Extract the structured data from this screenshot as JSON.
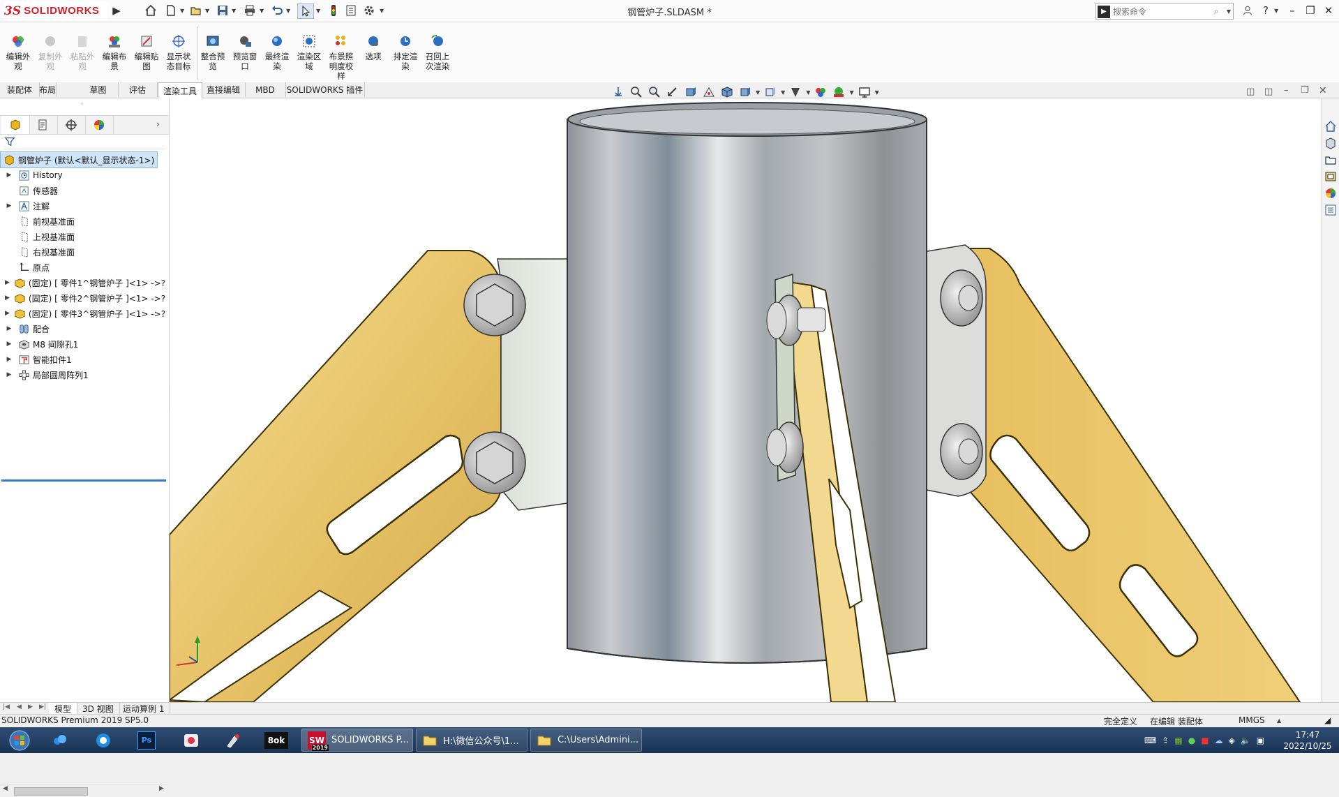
{
  "app": {
    "brand_ds": "3S",
    "brand_name": "SOLIDWORKS",
    "document_title": "钢管炉子.SLDASM *"
  },
  "search": {
    "placeholder": "搜索命令"
  },
  "command_manager": {
    "items": [
      {
        "label": "编辑外观",
        "enabled": true,
        "icon": "edit-appearance-icon"
      },
      {
        "label": "复制外观",
        "enabled": false,
        "icon": "copy-appearance-icon"
      },
      {
        "label": "粘贴外观",
        "enabled": false,
        "icon": "paste-appearance-icon"
      },
      {
        "label": "编辑布景",
        "enabled": true,
        "icon": "edit-scene-icon"
      },
      {
        "label": "编辑贴图",
        "enabled": true,
        "icon": "edit-decal-icon"
      },
      {
        "label": "显示状态目标",
        "enabled": true,
        "icon": "display-state-target-icon"
      },
      {
        "label": "整合预览",
        "enabled": true,
        "icon": "integrated-preview-icon"
      },
      {
        "label": "预览窗口",
        "enabled": true,
        "icon": "preview-window-icon"
      },
      {
        "label": "最终渲染",
        "enabled": true,
        "icon": "final-render-icon"
      },
      {
        "label": "渲染区域",
        "enabled": true,
        "icon": "render-region-icon"
      },
      {
        "label": "布景照明度校样",
        "enabled": true,
        "icon": "scene-illumination-proof-icon"
      },
      {
        "label": "选项",
        "enabled": true,
        "icon": "options-icon"
      },
      {
        "label": "排定渲染",
        "enabled": true,
        "icon": "schedule-render-icon"
      },
      {
        "label": "召回上次渲染",
        "enabled": true,
        "icon": "recall-last-render-icon"
      }
    ]
  },
  "tabs": [
    "装配体",
    "布局",
    "草图",
    "评估",
    "渲染工具",
    "直接编辑",
    "MBD",
    "SOLIDWORKS 插件"
  ],
  "active_tab": "渲染工具",
  "feature_tree": {
    "root": "钢管炉子  (默认<默认_显示状态-1>)",
    "items": [
      {
        "label": "History",
        "icon": "history-icon",
        "expandable": true
      },
      {
        "label": "传感器",
        "icon": "sensor-icon",
        "expandable": false
      },
      {
        "label": "注解",
        "icon": "annotation-icon",
        "expandable": true
      },
      {
        "label": "前视基准面",
        "icon": "plane-icon",
        "expandable": false
      },
      {
        "label": "上视基准面",
        "icon": "plane-icon",
        "expandable": false
      },
      {
        "label": "右视基准面",
        "icon": "plane-icon",
        "expandable": false
      },
      {
        "label": "原点",
        "icon": "origin-icon",
        "expandable": false
      },
      {
        "label": "(固定) [ 零件1^钢管炉子 ]<1> ->?",
        "icon": "part-icon",
        "expandable": true
      },
      {
        "label": "(固定) [ 零件2^钢管炉子 ]<1> ->?",
        "icon": "part-icon",
        "expandable": true
      },
      {
        "label": "(固定) [ 零件3^钢管炉子 ]<1> ->?",
        "icon": "part-icon",
        "expandable": true
      },
      {
        "label": "配合",
        "icon": "mates-icon",
        "expandable": true
      },
      {
        "label": "M8 间隙孔1",
        "icon": "hole-icon",
        "expandable": true
      },
      {
        "label": "智能扣件1",
        "icon": "smart-fastener-icon",
        "expandable": true
      },
      {
        "label": "局部圆周阵列1",
        "icon": "circular-pattern-icon",
        "expandable": true
      }
    ]
  },
  "bottom_tabs": [
    "模型",
    "3D 视图",
    "运动算例 1"
  ],
  "active_bottom_tab": "模型",
  "status": {
    "product": "SOLIDWORKS Premium 2019 SP5.0",
    "definition": "完全定义",
    "editing": "在编辑 装配体",
    "units": "MMGS"
  },
  "taskbar": {
    "windows": [
      {
        "label": "SOLIDWORKS P...",
        "icon": "solidworks-icon"
      },
      {
        "label": "H:\\微信公众号\\1...",
        "icon": "folder-icon"
      },
      {
        "label": "C:\\Users\\Admini...",
        "icon": "folder-icon"
      }
    ],
    "sw_badge": "2019",
    "clock_time": "17:47",
    "clock_date": "2022/10/25"
  },
  "colors": {
    "brand_red": "#d0202a",
    "bracket_gold": "#e9c86a",
    "pipe_steel": "#a9aeb4",
    "taskbar": "#1f3a5c",
    "selection_blue": "#2f7bd0"
  }
}
